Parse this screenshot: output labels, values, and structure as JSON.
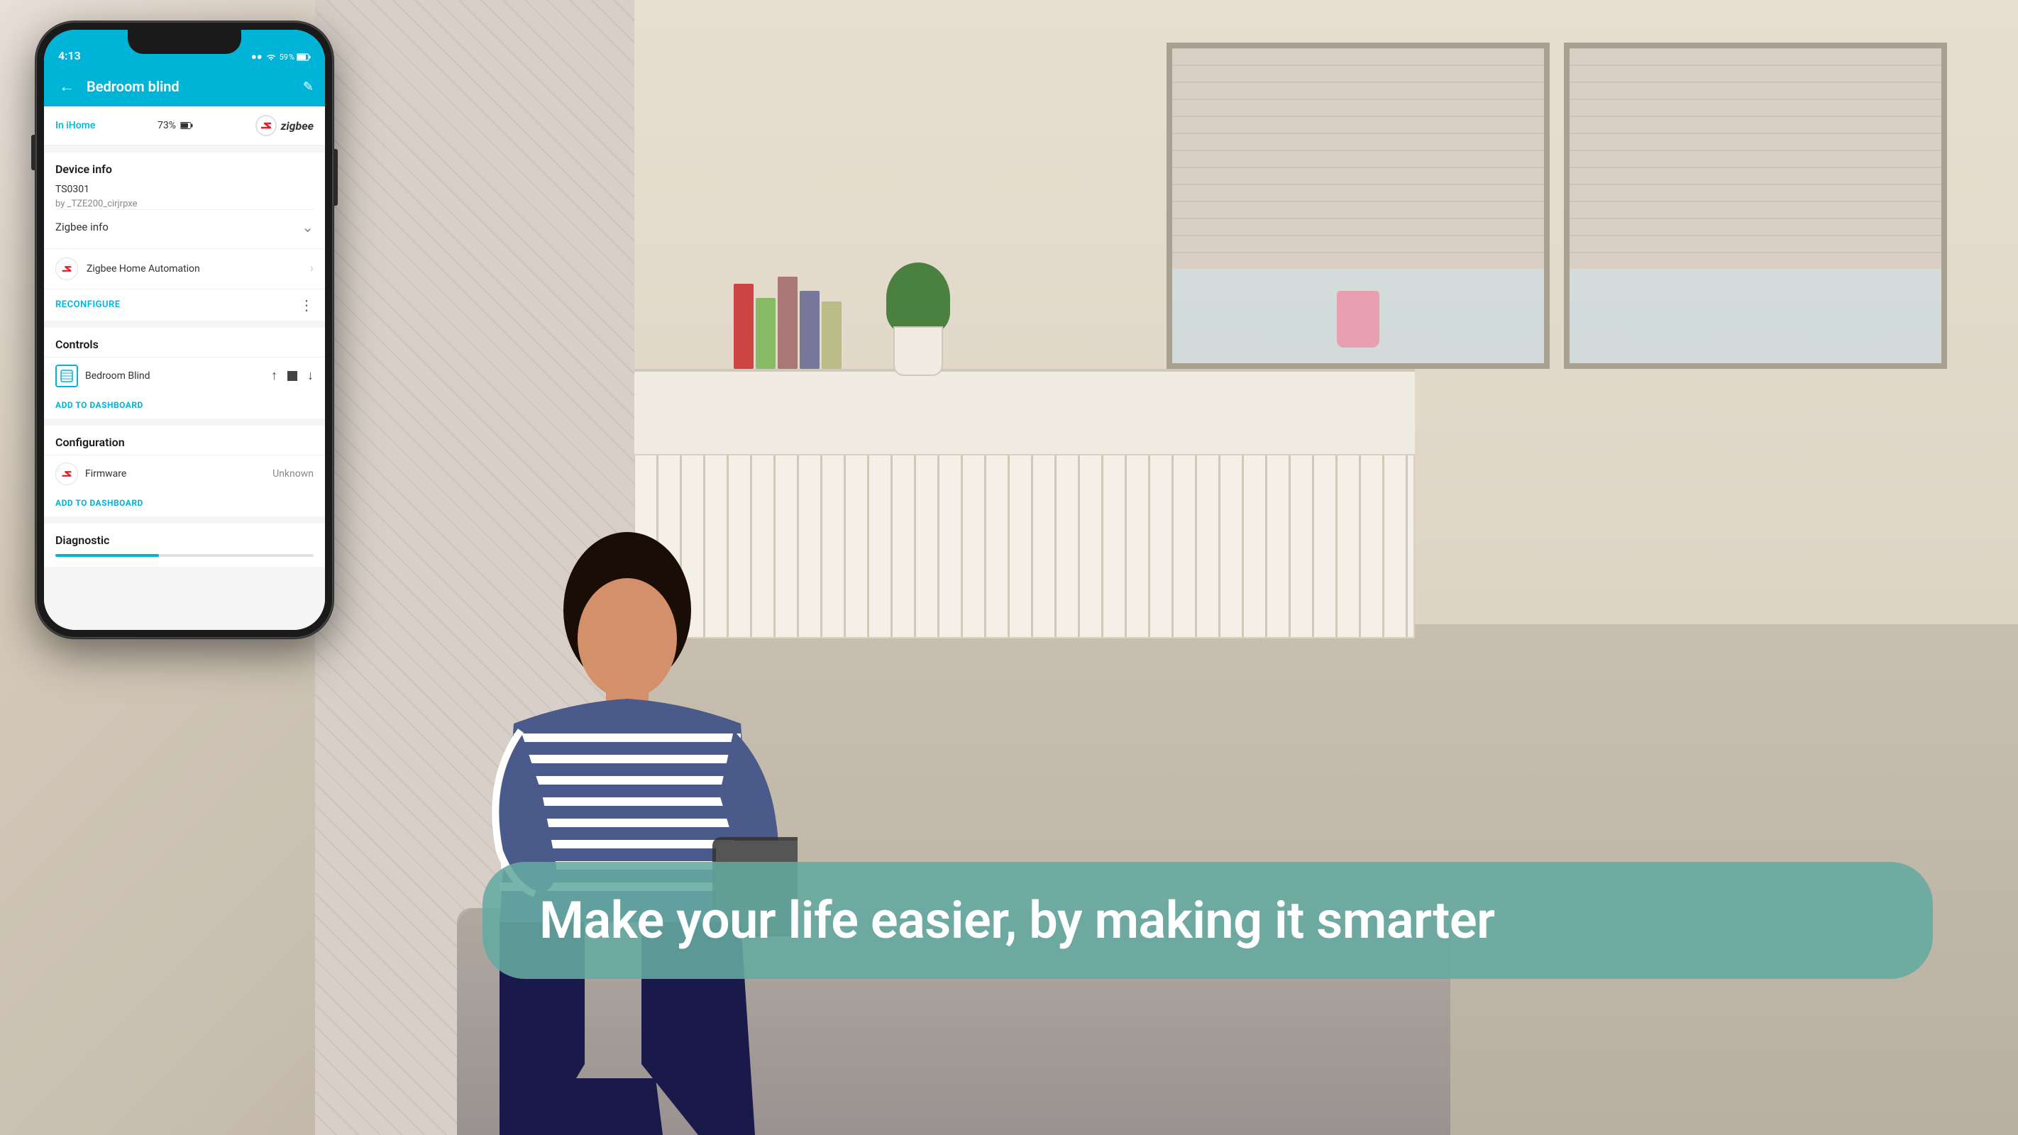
{
  "background": {
    "color": "#e8dfd0"
  },
  "tagline": {
    "text": "Make your life easier, by making it smarter",
    "bg_color": "rgba(100, 170, 160, 0.88)",
    "text_color": "#ffffff"
  },
  "phone": {
    "status_bar": {
      "time": "4:13",
      "battery_level": "59",
      "signal": "●●",
      "wifi": "WiFi"
    },
    "header": {
      "title": "Bedroom blind",
      "back_icon": "←",
      "edit_icon": "✎"
    },
    "info_row": {
      "location": "In iHome",
      "battery": "73%",
      "network": "zigbee"
    },
    "device_info": {
      "section_title": "Device info",
      "model": "TS0301",
      "manufacturer": "by _TZE200_cirjrpxe",
      "zigbee_info_label": "Zigbee info",
      "zigbee_home_automation": "Zigbee Home Automation",
      "reconfigure_label": "RECONFIGURE"
    },
    "controls": {
      "section_title": "Controls",
      "device_label": "Bedroom Blind",
      "up_icon": "↑",
      "stop_icon": "■",
      "down_icon": "↓",
      "add_dashboard_label": "ADD TO DASHBOARD"
    },
    "configuration": {
      "section_title": "Configuration",
      "firmware_label": "Firmware",
      "firmware_value": "Unknown",
      "add_dashboard_label": "ADD TO DASHBOARD"
    },
    "diagnostic": {
      "section_title": "Diagnostic"
    }
  }
}
